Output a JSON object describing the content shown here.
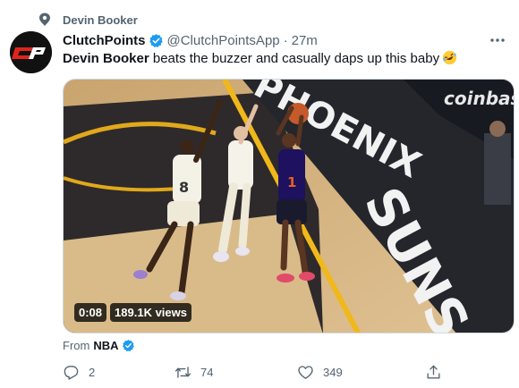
{
  "topic": {
    "label": "Devin Booker"
  },
  "author": {
    "display_name": "ClutchPoints",
    "handle": "@ClutchPointsApp",
    "separator": "·",
    "time": "27m",
    "avatar_text": "CP"
  },
  "tweet": {
    "mention": "Devin Booker",
    "text": " beats the buzzer and casually daps up this baby",
    "emoji": "rolling-on-floor-laughing"
  },
  "media": {
    "duration": "0:08",
    "views": "189.1K views",
    "court_signage": [
      "SUNS",
      "PHOENIX",
      "coinbase"
    ],
    "jersey_numbers": [
      "8",
      "1"
    ]
  },
  "source": {
    "prefix": "From",
    "name": "NBA"
  },
  "actions": {
    "replies": "2",
    "retweets": "74",
    "likes": "349"
  },
  "colors": {
    "verified": "#1d9bf0",
    "secondary_text": "#536471",
    "avatar_red": "#e1241b",
    "suns_purple": "#1d1160",
    "suns_orange": "#e56020"
  }
}
